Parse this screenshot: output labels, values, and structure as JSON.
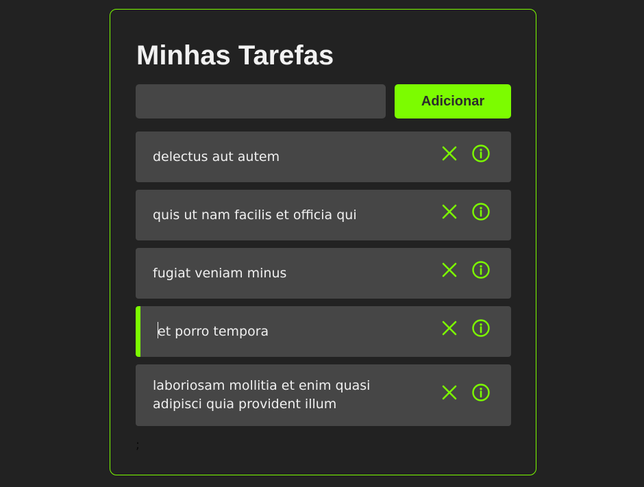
{
  "app": {
    "title": "Minhas Tarefas"
  },
  "input": {
    "value": "",
    "placeholder": ""
  },
  "add_button": {
    "label": "Adicionar"
  },
  "tasks": [
    {
      "text": "delectus aut autem",
      "selected": false
    },
    {
      "text": "quis ut nam facilis et officia qui",
      "selected": false
    },
    {
      "text": "fugiat veniam minus",
      "selected": false
    },
    {
      "text": "et porro tempora",
      "selected": true
    },
    {
      "text": "laboriosam mollitia et enim quasi adipisci quia provident illum",
      "selected": false
    }
  ],
  "footer": {
    "stray_text": ";"
  },
  "colors": {
    "accent": "#7cfc00",
    "background": "#222222",
    "card": "#464646",
    "text": "#f0f0f0"
  },
  "icons": {
    "remove": "close-icon",
    "details": "info-icon"
  }
}
